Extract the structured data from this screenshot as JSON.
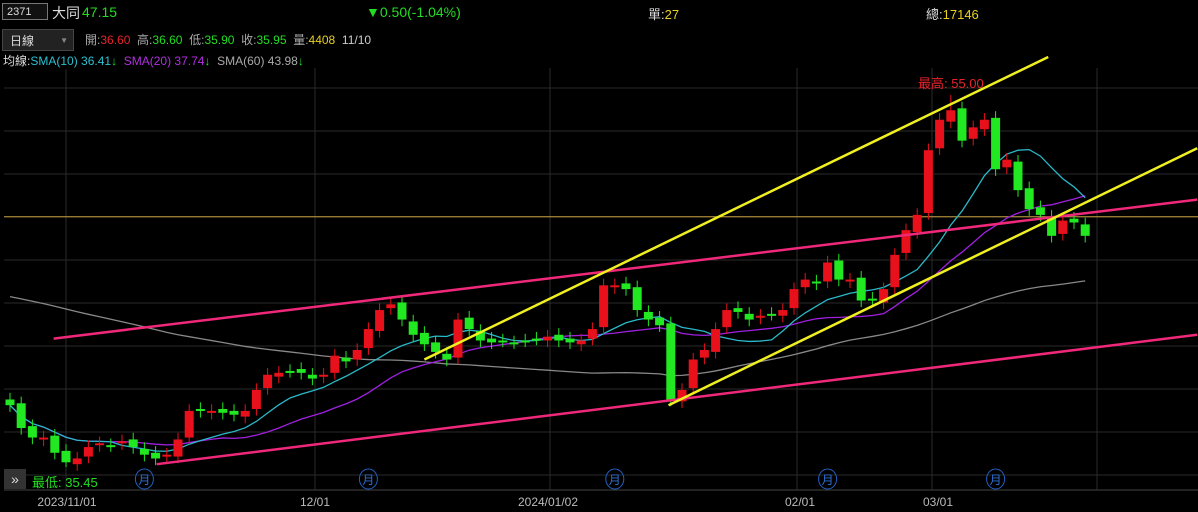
{
  "header": {
    "code": "2371",
    "name": "大同",
    "price": "47.15",
    "change": "▼0.50(-1.04%)",
    "unit_label": "單:",
    "unit_value": "27",
    "total_label": "總:",
    "total_value": "17146"
  },
  "toolbar": {
    "period": "日線",
    "open_label": "開:",
    "open": "36.60",
    "high_label": "高:",
    "high": "36.60",
    "low_label": "低:",
    "low": "35.90",
    "close_label": "收:",
    "close": "35.95",
    "vol_label": "量:",
    "vol": "4408",
    "date": "11/10"
  },
  "ma": {
    "label": "均線:",
    "sma10": "SMA(10) 36.41",
    "sma20": "SMA(20) 37.74",
    "sma60": "SMA(60) 43.98",
    "arrow": "↓"
  },
  "annotations": {
    "max": "最高: 55.00",
    "min": "最低: 35.45",
    "month_marker": "月"
  },
  "xaxis": {
    "labels": [
      "2023/11/01",
      "12/01",
      "2024/01/02",
      "02/01",
      "03/01"
    ]
  },
  "colors": {
    "up": "#e8101a",
    "down": "#22e822",
    "sma10": "#2bb8c8",
    "sma20": "#a020e0",
    "sma60": "#888888",
    "pink": "#f0287a",
    "yellow": "#f0f020",
    "hline": "#c8a040"
  },
  "chart_data": {
    "type": "candlestick",
    "price_range": [
      35.2,
      56.4
    ],
    "closes": [
      38.7,
      37.5,
      37.0,
      37.0,
      36.2,
      35.7,
      35.9,
      36.5,
      36.7,
      36.6,
      36.8,
      36.5,
      36.1,
      35.9,
      36.1,
      36.9,
      38.4,
      38.4,
      38.4,
      38.3,
      38.2,
      38.4,
      39.5,
      40.3,
      40.4,
      40.5,
      40.4,
      40.1,
      40.3,
      41.3,
      41.0,
      41.6,
      42.7,
      43.7,
      44.0,
      43.2,
      42.4,
      41.9,
      41.5,
      41.1,
      43.2,
      42.7,
      42.1,
      42.0,
      42.1,
      42.0,
      42.1,
      42.2,
      42.3,
      42.1,
      42.0,
      42.1,
      42.7,
      45.0,
      45.0,
      44.8,
      43.7,
      43.2,
      42.9,
      39.0,
      39.5,
      41.1,
      41.6,
      42.7,
      43.7,
      43.6,
      43.2,
      43.4,
      43.5,
      43.7,
      44.8,
      45.3,
      45.1,
      46.2,
      45.3,
      45.3,
      44.2,
      44.2,
      44.8,
      46.6,
      47.9,
      48.7,
      52.1,
      53.7,
      54.2,
      52.6,
      53.3,
      53.7,
      51.1,
      51.6,
      50.0,
      49.0,
      48.7,
      47.6,
      48.4,
      48.3,
      47.6
    ],
    "max": 55.0,
    "min": 35.45,
    "trendlines": [
      {
        "color": "pink",
        "from": [
          3.9,
          42.2
        ],
        "to": [
          106,
          49.5
        ]
      },
      {
        "color": "pink",
        "from": [
          13.1,
          35.6
        ],
        "to": [
          106,
          42.4
        ]
      },
      {
        "color": "yellow",
        "from": [
          37,
          41.1
        ],
        "to": [
          92.7,
          57.0
        ]
      },
      {
        "color": "yellow",
        "from": [
          58.8,
          38.7
        ],
        "to": [
          106,
          52.2
        ]
      }
    ],
    "hline": 48.6,
    "month_markers": [
      12,
      32,
      54,
      73,
      88
    ]
  }
}
